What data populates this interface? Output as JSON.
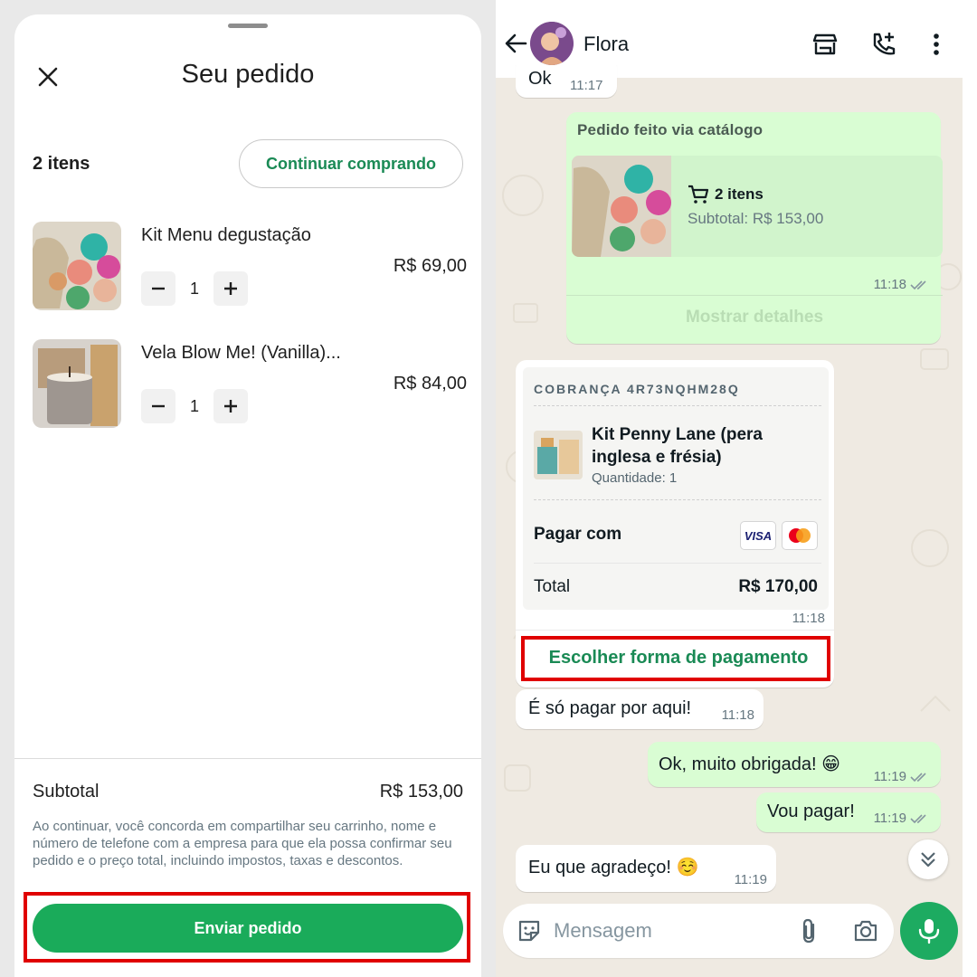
{
  "cart": {
    "title": "Seu pedido",
    "items_count": "2 itens",
    "continue_label": "Continuar comprando",
    "products": [
      {
        "name": "Kit Menu degustação",
        "quantity": "1",
        "price": "R$ 69,00"
      },
      {
        "name": "Vela Blow Me! (Vanilla)...",
        "quantity": "1",
        "price": "R$ 84,00"
      }
    ],
    "subtotal_label": "Subtotal",
    "subtotal_value": "R$ 153,00",
    "disclaimer": "Ao continuar, você concorda em compartilhar seu carrinho, nome e número de telefone com a empresa para que ela possa confirmar seu pedido e o preço total, incluindo impostos, taxas e descontos.",
    "send_label": "Enviar pedido"
  },
  "chat": {
    "contact_name": "Flora",
    "messages": {
      "ok": {
        "text": "Ok",
        "time": "11:17"
      },
      "order": {
        "title": "Pedido feito via catálogo",
        "count": "2 itens",
        "subtotal": "Subtotal: R$ 153,00",
        "time": "11:18",
        "details_label": "Mostrar detalhes"
      },
      "charge": {
        "code": "COBRANÇA 4R73NQHM28Q",
        "product_name": "Kit Penny Lane (pera inglesa e frésia)",
        "quantity": "Quantidade: 1",
        "pay_with": "Pagar com",
        "card_visa": "VISA",
        "total_label": "Total",
        "total_value": "R$ 170,00",
        "time": "11:18",
        "choose_payment": "Escolher forma de pagamento"
      },
      "pay_here": {
        "text": "É só pagar por aqui!",
        "time": "11:18"
      },
      "thanks": {
        "text": "Ok, muito obrigada! 😁",
        "time": "11:19"
      },
      "will_pay": {
        "text": "Vou pagar!",
        "time": "11:19"
      },
      "welcome": {
        "text": "Eu que agradeço! ☺️",
        "time": "11:19"
      }
    },
    "composer_placeholder": "Mensagem"
  },
  "colors": {
    "accent_green": "#1aab5a",
    "link_green": "#1a8a55",
    "outgoing_bubble": "#d9fdd3",
    "chat_background": "#efeae2",
    "highlight_red": "#e00000"
  },
  "icons": [
    "close-icon",
    "minus-icon",
    "plus-icon",
    "back-arrow-icon",
    "store-icon",
    "add-call-icon",
    "more-vert-icon",
    "cart-icon",
    "double-check-icon",
    "visa-icon",
    "mastercard-icon",
    "chevron-double-down-icon",
    "sticker-icon",
    "attach-icon",
    "camera-icon",
    "mic-icon"
  ]
}
